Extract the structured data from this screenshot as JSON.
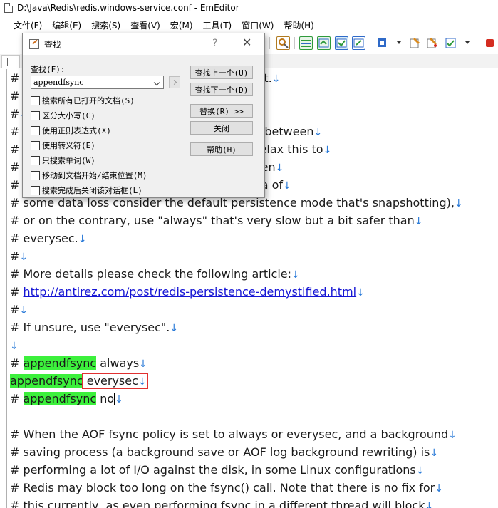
{
  "window": {
    "title": "D:\\Java\\Redis\\redis.windows-service.conf - EmEditor"
  },
  "menu": [
    "文件(F)",
    "编辑(E)",
    "搜索(S)",
    "查看(V)",
    "宏(M)",
    "工具(T)",
    "窗口(W)",
    "帮助(H)"
  ],
  "find_dialog": {
    "title": "查找",
    "help_glyph": "?",
    "close_glyph": "✕",
    "find_label": "查找(F):",
    "find_value": "appendfsync",
    "options": [
      {
        "label": "搜索所有已打开的文档(S)",
        "checked": false
      },
      {
        "label": "区分大小写(C)",
        "checked": false
      },
      {
        "label": "使用正则表达式(X)",
        "checked": false
      },
      {
        "label": "使用转义符(E)",
        "checked": false
      },
      {
        "label": "只搜索单词(W)",
        "checked": false
      },
      {
        "label": "移动到文档开始/结束位置(M)",
        "checked": false
      },
      {
        "label": "搜索完成后关闭该对话框(L)",
        "checked": false
      }
    ],
    "buttons": {
      "find_prev": "查找上一个(U)",
      "find_next": "查找下一个(D)",
      "replace": "替换(R) >>",
      "close": "关闭",
      "help": "帮助(H)"
    }
  },
  "editor": {
    "eol": "↓",
    "lines": [
      {
        "parts": [
          {
            "t": "# "
          },
          {
            "t": "                                  only log. Slow, Safest."
          }
        ],
        "eol": true
      },
      {
        "parts": [
          {
            "t": "# e"
          },
          {
            "t": "                                 Compromise."
          }
        ],
        "eol": true
      },
      {
        "parts": [
          {
            "t": "#"
          }
        ],
        "eol": true
      },
      {
        "parts": [
          {
            "t": "# T"
          },
          {
            "t": "                                 e right compromise between"
          }
        ],
        "eol": true
      },
      {
        "parts": [
          {
            "t": "# s"
          },
          {
            "t": "                                 erstand if you can relax this to"
          }
        ],
        "eol": true
      },
      {
        "parts": [
          {
            "t": "# \""
          },
          {
            "t": "                                 he output buffer when"
          }
        ],
        "eol": true
      },
      {
        "parts": [
          {
            "t": "# i"
          },
          {
            "t": "                                 can live with the idea of"
          }
        ],
        "eol": true
      },
      {
        "parts": [
          {
            "t": "# some data loss consider the default persistence mode that's snapshotting),"
          }
        ],
        "eol": true
      },
      {
        "parts": [
          {
            "t": "# or on the contrary, use \"always\" that's very slow but a bit safer than"
          }
        ],
        "eol": true
      },
      {
        "parts": [
          {
            "t": "# everysec."
          }
        ],
        "eol": true
      },
      {
        "parts": [
          {
            "t": "#"
          }
        ],
        "eol": true
      },
      {
        "parts": [
          {
            "t": "# More details please check the following article:"
          }
        ],
        "eol": true
      },
      {
        "parts": [
          {
            "t": "# "
          },
          {
            "t": "http://antirez.com/post/redis-persistence-demystified.html",
            "link": true
          }
        ],
        "eol": true
      },
      {
        "parts": [
          {
            "t": "#"
          }
        ],
        "eol": true
      },
      {
        "parts": [
          {
            "t": "# If unsure, use \"everysec\"."
          }
        ],
        "eol": true
      },
      {
        "parts": [],
        "eol": true
      },
      {
        "parts": [
          {
            "t": "# "
          },
          {
            "t": "appendfsync",
            "hl": true
          },
          {
            "t": " always"
          }
        ],
        "eol": true
      },
      {
        "parts": [
          {
            "t": "appendfsync",
            "hl": true
          },
          {
            "t": " everysec",
            "boxed": true
          }
        ],
        "eol": true,
        "eol_boxed": true
      },
      {
        "parts": [
          {
            "t": "# "
          },
          {
            "t": "appendfsync",
            "hl": true
          },
          {
            "t": " no"
          }
        ],
        "eol": true,
        "caret": true
      },
      {
        "parts": [],
        "eol": false
      },
      {
        "parts": [
          {
            "t": "# When the AOF fsync policy is set to always or everysec, and a background"
          }
        ],
        "eol": true
      },
      {
        "parts": [
          {
            "t": "# saving process (a background save or AOF log background rewriting) is"
          }
        ],
        "eol": true
      },
      {
        "parts": [
          {
            "t": "# performing a lot of I/O against the disk, in some Linux configurations"
          }
        ],
        "eol": true
      },
      {
        "parts": [
          {
            "t": "# Redis may block too long on the fsync() call. Note that there is no fix for"
          }
        ],
        "eol": true
      },
      {
        "parts": [
          {
            "t": "# this currently, as even performing fsync in a different thread will block"
          }
        ],
        "eol": true
      }
    ]
  },
  "toolbar": {
    "icons": [
      "new-icon",
      "open-icon",
      "save-icon",
      "print-icon",
      "cut-icon",
      "copy-icon",
      "paste-icon",
      "undo-icon",
      "redo-icon",
      "find-icon",
      "find-next-icon",
      "find-prev-icon",
      "replace-icon",
      "view-icon",
      "wrap-icon",
      "display-icon",
      "macro-icon",
      "tool-icon",
      "settings-icon",
      "record-icon"
    ],
    "colors": {
      "green": "#2f9a3c",
      "blue": "#2f6ac8",
      "orange": "#d98a1e",
      "red": "#d42c20"
    }
  }
}
